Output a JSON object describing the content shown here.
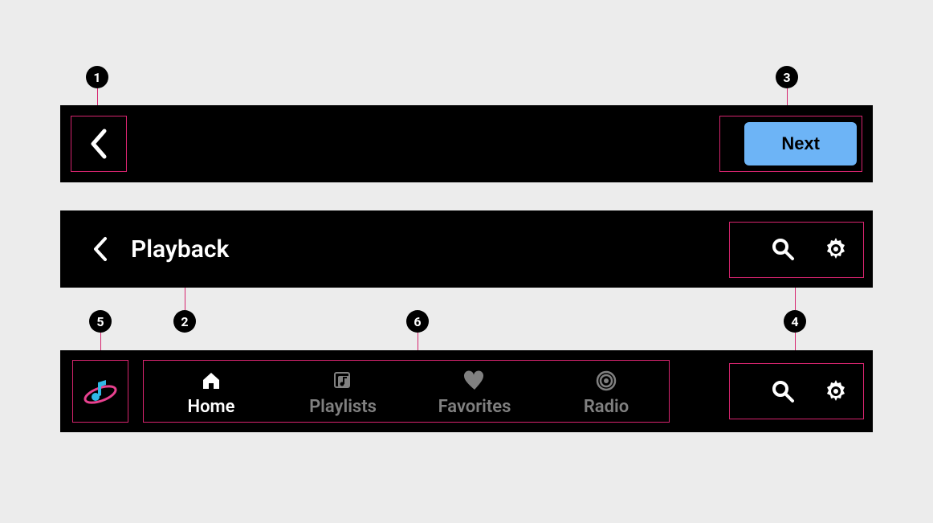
{
  "markers": {
    "m1": "1",
    "m2": "2",
    "m3": "3",
    "m4": "4",
    "m5": "5",
    "m6": "6"
  },
  "bar1": {
    "next_label": "Next"
  },
  "bar2": {
    "title": "Playback"
  },
  "bar3": {
    "tabs": [
      {
        "label": "Home",
        "active": true
      },
      {
        "label": "Playlists",
        "active": false
      },
      {
        "label": "Favorites",
        "active": false
      },
      {
        "label": "Radio",
        "active": false
      }
    ]
  }
}
